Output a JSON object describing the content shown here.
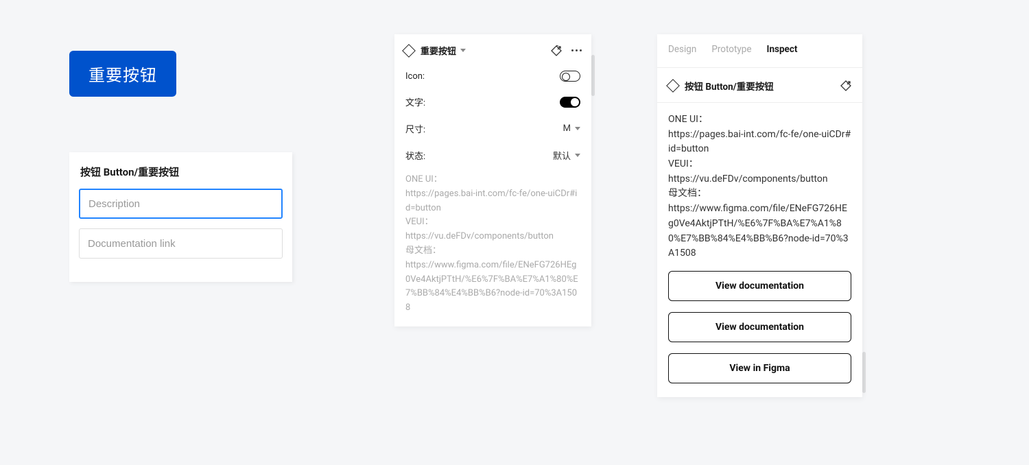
{
  "panel1": {
    "button_label": "重要按钮",
    "card_title": "按钮 Button/重要按钮",
    "description_placeholder": "Description",
    "doc_link_placeholder": "Documentation link"
  },
  "panel2": {
    "title": "重要按钮",
    "props": {
      "icon_label": "Icon:",
      "icon_on": false,
      "text_label": "文字:",
      "text_on": true,
      "size_label": "尺寸:",
      "size_value": "M",
      "state_label": "状态:",
      "state_value": "默认"
    },
    "description": "ONE UI：\nhttps://pages.bai-int.com/fc-fe/one-uiCDr#id=button\nVEUI：\nhttps://vu.deFDv/components/button\n母文档：\nhttps://www.figma.com/file/ENeFG726HEg0Ve4AktjPTtH/%E6%7F%BA%E7%A1%80%E7%BB%84%E4%BB%B6?node-id=70%3A1508"
  },
  "panel3": {
    "tabs": {
      "design": "Design",
      "prototype": "Prototype",
      "inspect": "Inspect"
    },
    "active_tab": "inspect",
    "title": "按钮 Button/重要按钮",
    "description": "ONE UI：\nhttps://pages.bai-int.com/fc-fe/one-uiCDr#id=button\nVEUI：\nhttps://vu.deFDv/components/button\n母文档：\nhttps://www.figma.com/file/ENeFG726HEg0Ve4AktjPTtH/%E6%7F%BA%E7%A1%80%E7%BB%84%E4%BB%B6?node-id=70%3A1508",
    "buttons": {
      "view_doc_1": "View documentation",
      "view_doc_2": "View documentation",
      "view_in_figma": "View in Figma"
    }
  }
}
